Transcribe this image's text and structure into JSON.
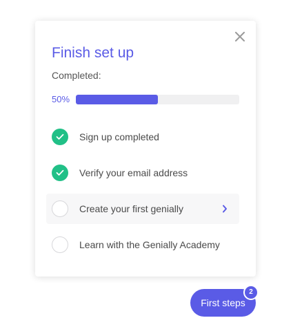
{
  "panel": {
    "title": "Finish set up",
    "subtitle": "Completed:",
    "progress": {
      "label": "50%",
      "value": 50
    },
    "steps": [
      {
        "label": "Sign up completed",
        "status": "completed"
      },
      {
        "label": "Verify your email address",
        "status": "completed"
      },
      {
        "label": "Create your first genially",
        "status": "pending",
        "highlighted": true
      },
      {
        "label": "Learn with the Genially Academy",
        "status": "pending"
      }
    ]
  },
  "launcher": {
    "label": "First steps",
    "badge": "2"
  },
  "icons": {
    "close": "close-icon",
    "check": "check-icon",
    "chevron": "chevron-right-icon"
  },
  "colors": {
    "accent": "#5a5be6",
    "success": "#21c087",
    "track": "#f0f0f1",
    "highlight_row": "#f7f7f8"
  }
}
